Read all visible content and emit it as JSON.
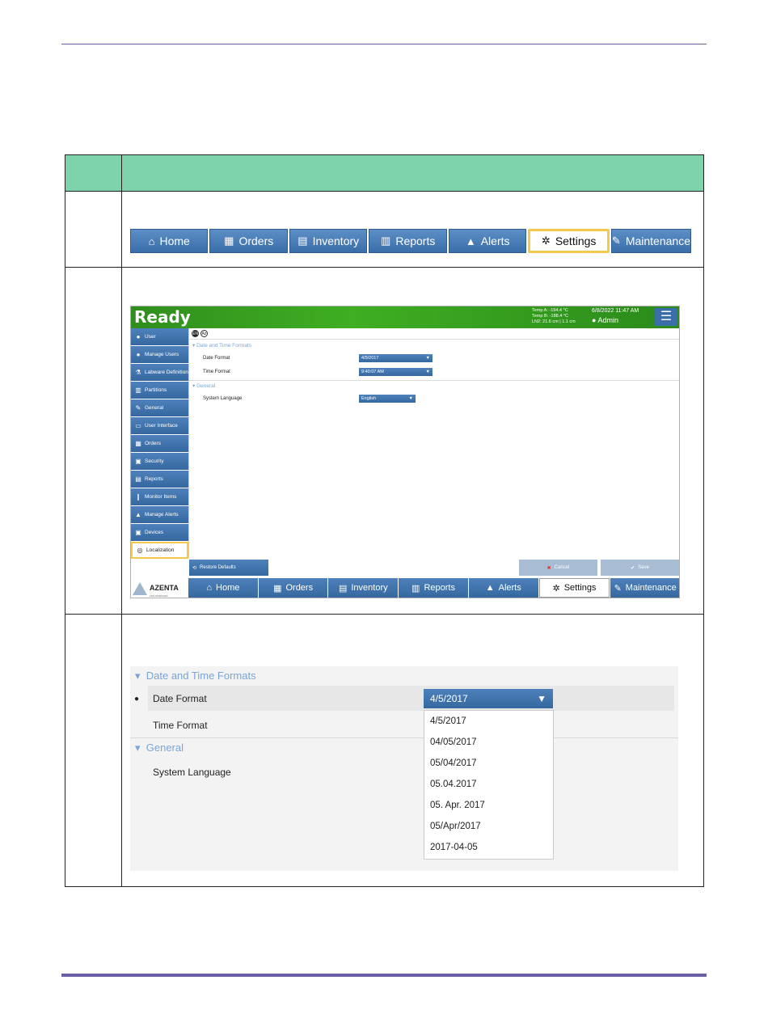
{
  "nav_top": {
    "items": [
      {
        "label": "Home",
        "icon": "home-icon",
        "glyph": "⌂"
      },
      {
        "label": "Orders",
        "icon": "orders-icon",
        "glyph": "▦"
      },
      {
        "label": "Inventory",
        "icon": "inventory-icon",
        "glyph": "▤"
      },
      {
        "label": "Reports",
        "icon": "reports-icon",
        "glyph": "▥"
      },
      {
        "label": "Alerts",
        "icon": "alert-icon",
        "glyph": "▲"
      },
      {
        "label": "Settings",
        "icon": "gear-icon",
        "glyph": "✲",
        "active": true
      },
      {
        "label": "Maintenance",
        "icon": "wrench-icon",
        "glyph": "✎"
      }
    ]
  },
  "screen": {
    "status": "Ready",
    "temp_a": "Temp A: -194.4 °C",
    "temp_b": "Temp B: -188.4 °C",
    "ln2": "LN2: 21.6 cm | 1.1 cm",
    "datetime": "6/8/2022 11:47 AM",
    "user": "Admin",
    "sidebar": [
      {
        "label": "User",
        "glyph": "●"
      },
      {
        "label": "Manage Users",
        "glyph": "●"
      },
      {
        "label": "Labware Definition",
        "glyph": "⚗"
      },
      {
        "label": "Partitions",
        "glyph": "▥"
      },
      {
        "label": "General",
        "glyph": "✎"
      },
      {
        "label": "User Interface",
        "glyph": "▭"
      },
      {
        "label": "Orders",
        "glyph": "▦"
      },
      {
        "label": "Security",
        "glyph": "▣"
      },
      {
        "label": "Reports",
        "glyph": "▤"
      },
      {
        "label": "Monitor Items",
        "glyph": "❙"
      },
      {
        "label": "Manage Alerts",
        "glyph": "▲"
      },
      {
        "label": "Devices",
        "glyph": "▣"
      },
      {
        "label": "Localization",
        "glyph": "◎",
        "active": true
      }
    ],
    "tool_en": "EN",
    "tool_az": "Az",
    "section_datetime": "Date and Time Formats",
    "date_format_label": "Date Format",
    "date_format_value": "4/5/2017",
    "time_format_label": "Time Format",
    "time_format_value": "9:40:07 AM",
    "section_general": "General",
    "language_label": "System Language",
    "language_value": "English",
    "restore_label": "Restore Defaults",
    "cancel_label": "Cancel",
    "save_label": "Save",
    "logo_text": "AZENTA",
    "logo_sub": "LIFE SCIENCES",
    "nav": [
      "Home",
      "Orders",
      "Inventory",
      "Reports",
      "Alerts",
      "Settings",
      "Maintenance"
    ]
  },
  "zoom": {
    "section_datetime": "Date and Time Formats",
    "date_format_label": "Date Format",
    "date_format_value": "4/5/2017",
    "time_format_label": "Time Format",
    "section_general": "General",
    "language_label": "System Language",
    "options": [
      "4/5/2017",
      "04/05/2017",
      "05/04/2017",
      "05.04.2017",
      "05. Apr. 2017",
      "05/Apr/2017",
      "2017-04-05"
    ]
  }
}
